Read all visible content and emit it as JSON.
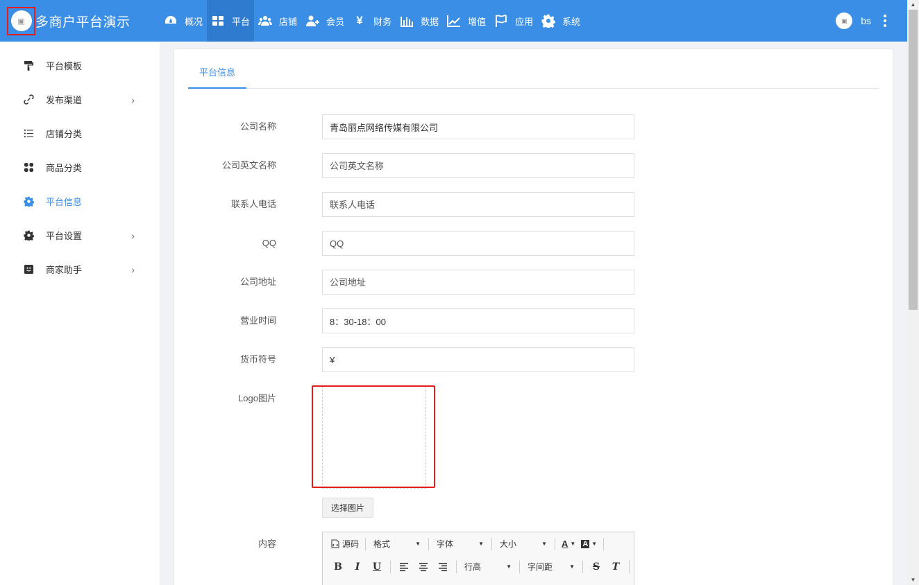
{
  "app": {
    "title": "多商户平台演示",
    "logo_text": "▣"
  },
  "topnav": {
    "items": [
      {
        "label": "概况",
        "icon": "dashboard-icon"
      },
      {
        "label": "平台",
        "icon": "grid-icon"
      },
      {
        "label": "店铺",
        "icon": "users-icon"
      },
      {
        "label": "会员",
        "icon": "user-add-icon"
      },
      {
        "label": "财务",
        "icon": "yen-icon"
      },
      {
        "label": "数据",
        "icon": "bar-chart-icon"
      },
      {
        "label": "增值",
        "icon": "line-chart-icon"
      },
      {
        "label": "应用",
        "icon": "flag-icon"
      },
      {
        "label": "系统",
        "icon": "gear-icon"
      }
    ],
    "active_index": 1,
    "user": "bs",
    "yen_glyph": "¥"
  },
  "sidebar": {
    "items": [
      {
        "label": "平台模板",
        "icon": "paint-roller-icon",
        "has_submenu": false
      },
      {
        "label": "发布渠道",
        "icon": "link-icon",
        "has_submenu": true
      },
      {
        "label": "店铺分类",
        "icon": "list-icon",
        "has_submenu": false
      },
      {
        "label": "商品分类",
        "icon": "apps-icon",
        "has_submenu": false
      },
      {
        "label": "平台信息",
        "icon": "gear-icon",
        "has_submenu": false,
        "active": true
      },
      {
        "label": "平台设置",
        "icon": "gear-icon",
        "has_submenu": true
      },
      {
        "label": "商家助手",
        "icon": "smile-icon",
        "has_submenu": true
      }
    ],
    "chevron": "›"
  },
  "main": {
    "tab": "平台信息",
    "fields": {
      "company_name": {
        "label": "公司名称",
        "value": "青岛丽点网络传媒有限公司",
        "placeholder": ""
      },
      "company_en_name": {
        "label": "公司英文名称",
        "value": "",
        "placeholder": "公司英文名称"
      },
      "contact_phone": {
        "label": "联系人电话",
        "value": "",
        "placeholder": "联系人电话"
      },
      "qq": {
        "label": "QQ",
        "value": "",
        "placeholder": "QQ"
      },
      "address": {
        "label": "公司地址",
        "value": "",
        "placeholder": "公司地址"
      },
      "business_hours": {
        "label": "营业时间",
        "value": "8：30-18：00",
        "placeholder": ""
      },
      "currency": {
        "label": "货币符号",
        "value": "¥",
        "placeholder": ""
      }
    },
    "logo": {
      "label": "Logo图片",
      "button": "选择图片"
    },
    "content": {
      "label": "内容",
      "toolbar": {
        "source": "源码",
        "format": "格式",
        "font": "字体",
        "size": "大小",
        "line_height": "行高",
        "letter_spacing": "字间距",
        "bold": "B",
        "italic": "I",
        "underline": "U",
        "strike": "S",
        "clear": "T",
        "font_color": "A",
        "bg_color": "A"
      }
    }
  }
}
